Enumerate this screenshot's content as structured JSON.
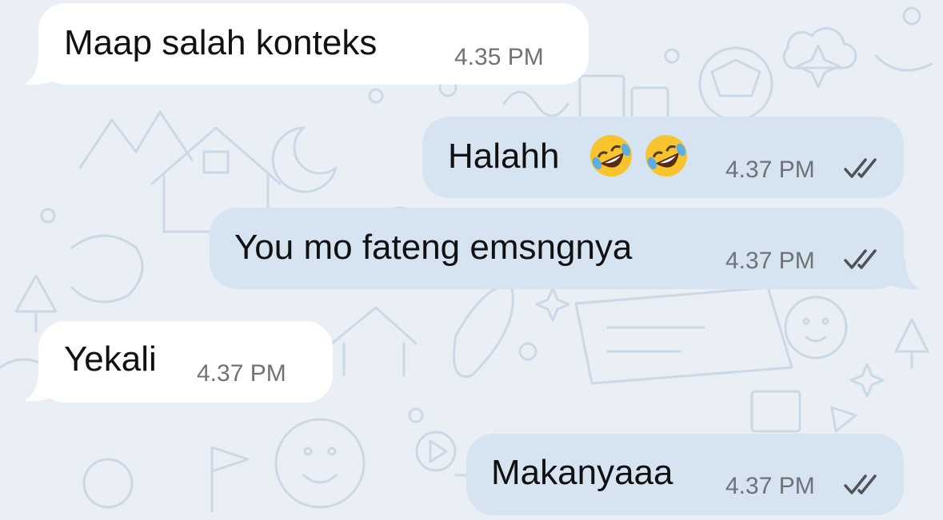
{
  "colors": {
    "background": "#e9eff5",
    "incoming_bubble": "#ffffff",
    "outgoing_bubble": "#d6e3f1",
    "text": "#111111",
    "timestamp": "#6f7276",
    "read_ticks": "#4f5358"
  },
  "messages": [
    {
      "direction": "incoming",
      "text": "Maap salah konteks",
      "time": "4.35 PM"
    },
    {
      "direction": "outgoing",
      "text": "Halahh",
      "emoji": [
        "rolling-on-floor-laughing",
        "rolling-on-floor-laughing"
      ],
      "time": "4.37 PM",
      "status": "read"
    },
    {
      "direction": "outgoing",
      "text": "You mo fateng emsngnya",
      "time": "4.37 PM",
      "status": "read"
    },
    {
      "direction": "incoming",
      "text": "Yekali",
      "time": "4.37 PM"
    },
    {
      "direction": "outgoing",
      "text": "Makanyaaa",
      "time": "4.37 PM",
      "status": "read"
    }
  ]
}
